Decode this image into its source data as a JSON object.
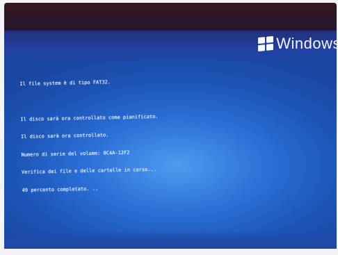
{
  "logo": {
    "text": "Windows",
    "icon": "windows-flag-icon"
  },
  "console": {
    "lines": [
      "Il file system è di tipo FAT32.",
      "",
      "Il disco sarà ora controllato come pianificato.",
      "Il disco sarà ora controllato.",
      "Numero di serie del volume: 0C4A-12F2",
      "Verifica dei file e delle cartelle in corso...",
      "49 percento completato. .."
    ]
  },
  "colors": {
    "screen_blue": "#2b6fd6",
    "text": "#e9f1ff"
  }
}
